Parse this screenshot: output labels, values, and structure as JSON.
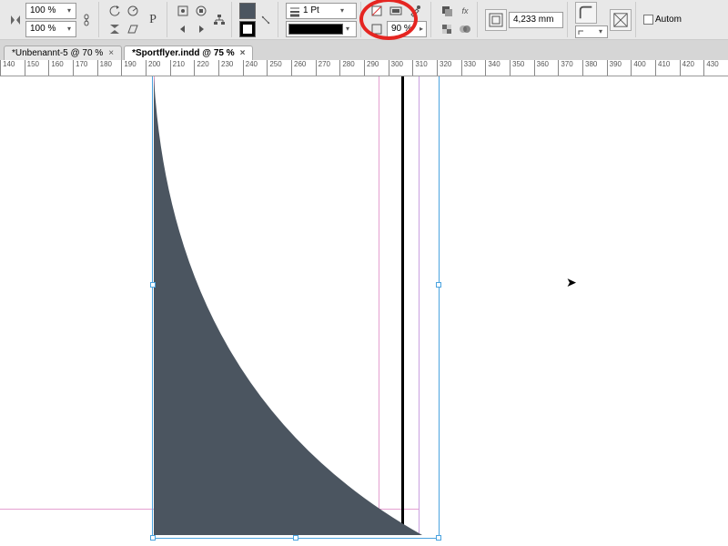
{
  "toolbar": {
    "scale_x": "100 %",
    "scale_y": "100 %",
    "stroke_weight": "1 Pt",
    "tint_top": "",
    "tint_value": "90 %",
    "size_field": "4,233 mm",
    "autom_label": "Autom",
    "fill_color": "#4b5560",
    "stroke_color": "#000000"
  },
  "tabs": [
    {
      "label": "*Unbenannt-5 @ 70 %",
      "active": false
    },
    {
      "label": "*Sportflyer.indd @ 75 %",
      "active": true
    }
  ],
  "ruler": {
    "start": 140,
    "step": 10,
    "count": 30
  },
  "shape_fill": "#4b5560"
}
